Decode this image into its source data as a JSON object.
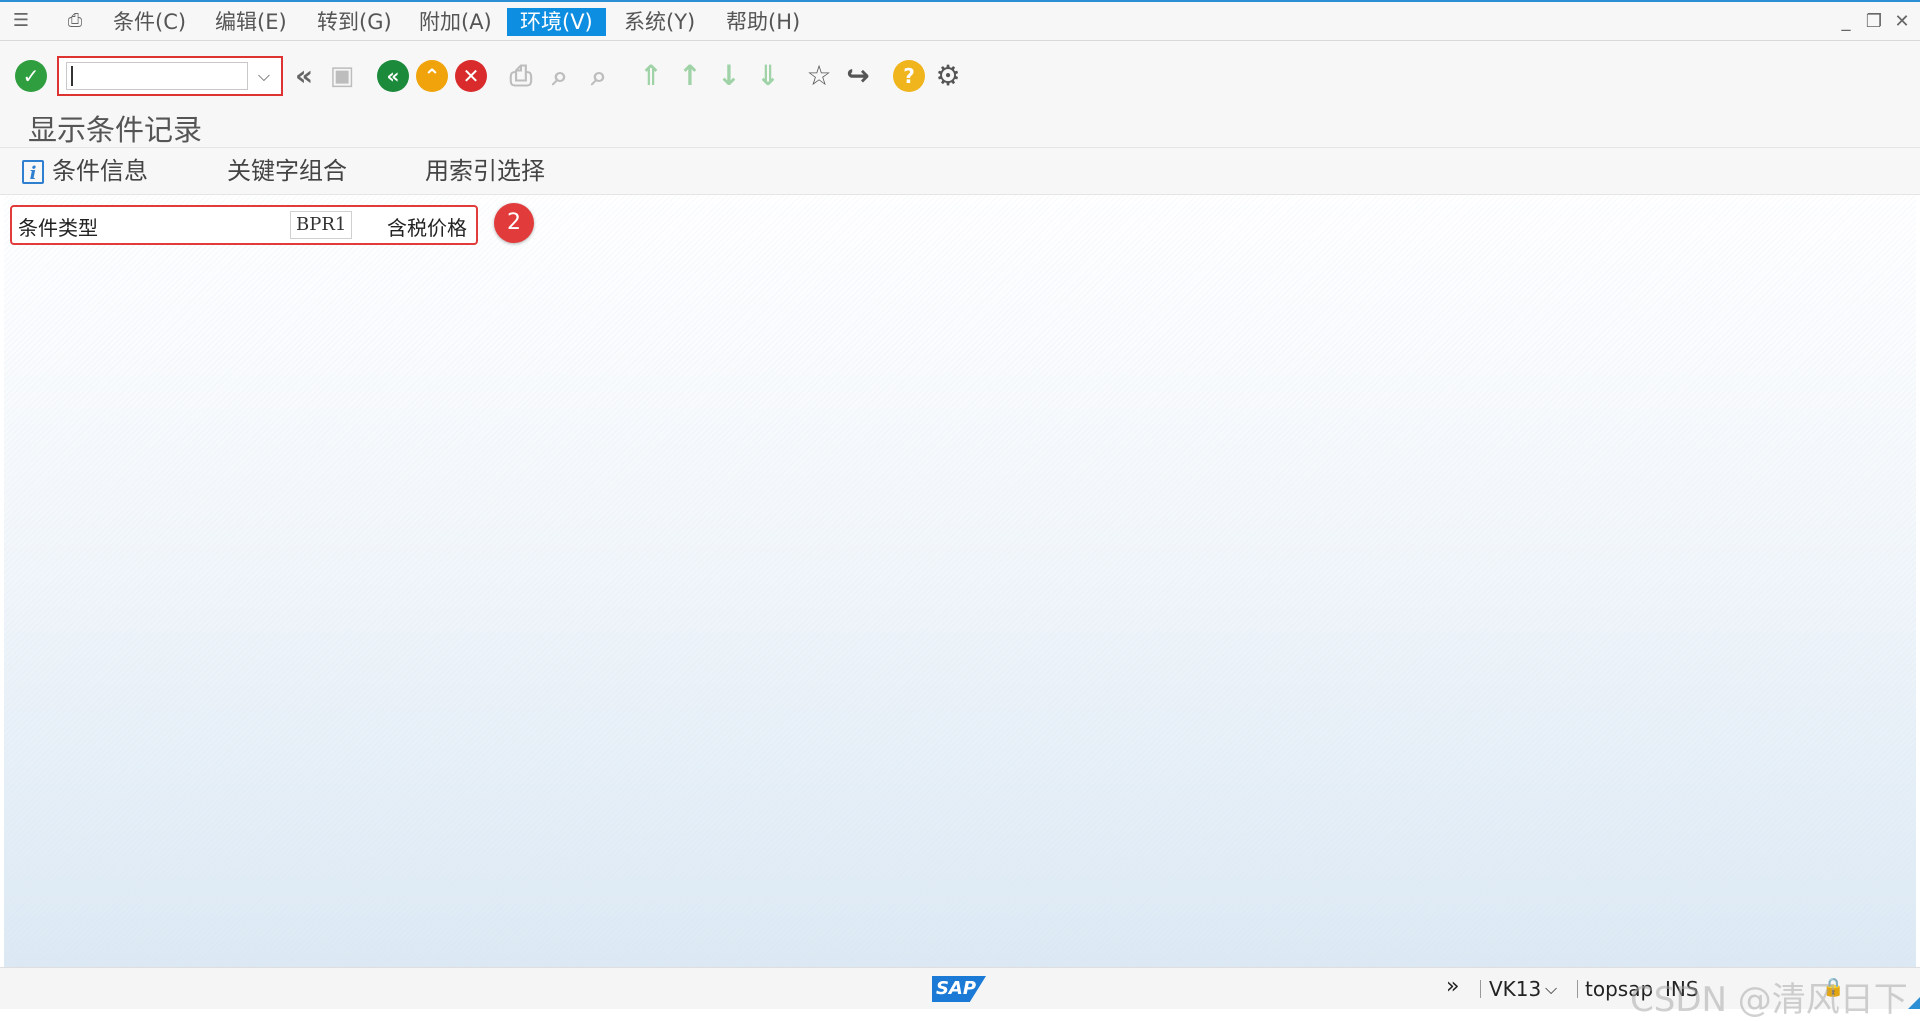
{
  "menubar": {
    "items": [
      {
        "label": "条件(C)"
      },
      {
        "label": "编辑(E)"
      },
      {
        "label": "转到(G)"
      },
      {
        "label": "附加(A)"
      },
      {
        "label": "环境(V)"
      },
      {
        "label": "系统(Y)"
      },
      {
        "label": "帮助(H)"
      }
    ],
    "active_index": 4
  },
  "toolbar": {
    "command_field_value": "",
    "icons": [
      "enter-icon",
      "back-double-icon",
      "save-icon",
      "back-icon",
      "exit-icon",
      "cancel-icon",
      "print-icon",
      "find-icon",
      "find-next-icon",
      "first-page-icon",
      "previous-page-icon",
      "next-page-icon",
      "last-page-icon",
      "create-session-icon",
      "generate-shortcut-icon",
      "help-icon",
      "settings-icon"
    ]
  },
  "page": {
    "title": "显示条件记录"
  },
  "app_toolbar": {
    "condition_info_label": "条件信息",
    "key_combination_label": "关键字组合",
    "index_selection_label": "用索引选择"
  },
  "form": {
    "condition_type_label": "条件类型",
    "condition_type_value": "BPR1",
    "condition_type_desc": "含税价格"
  },
  "annotation": {
    "step_number": "2"
  },
  "statusbar": {
    "logo_text": "SAP",
    "transaction": "VK13",
    "server": "topsap",
    "mode": "INS",
    "watermark": "CSDN @清风日下"
  },
  "colors": {
    "accent": "#0e8ee0",
    "annotation_red": "#e23b3b",
    "enter_green": "#2e9e3f",
    "back_green": "#1b8a3a",
    "exit_orange": "#f0a30a",
    "cancel_red": "#d92b2b",
    "help_yellow": "#f0b41c"
  }
}
